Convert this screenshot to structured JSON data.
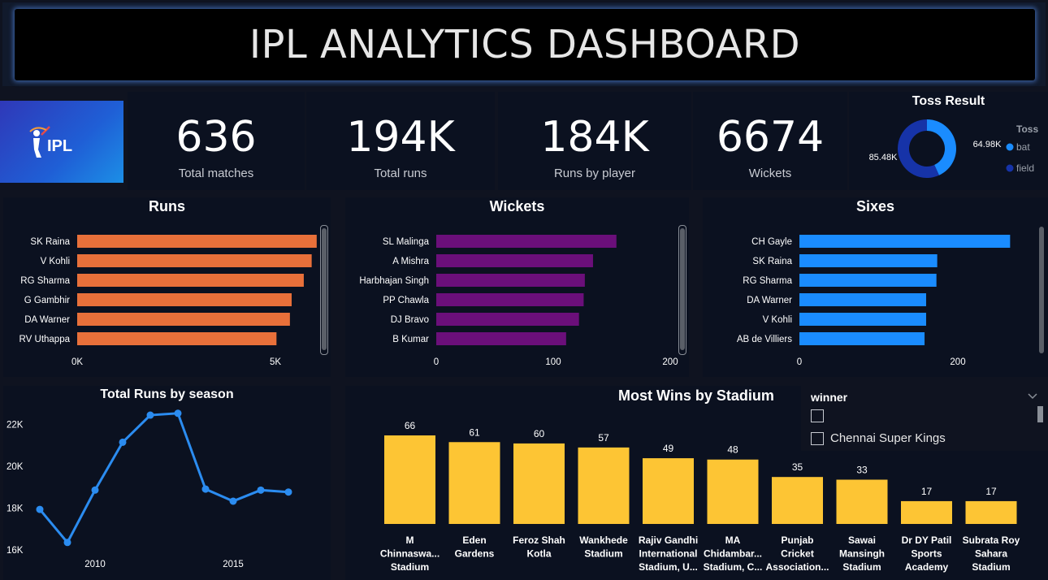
{
  "header": {
    "title": "IPL ANALYTICS DASHBOARD"
  },
  "logo": {
    "text": "IPL"
  },
  "kpis": [
    {
      "value": "636",
      "label": "Total matches"
    },
    {
      "value": "194K",
      "label": "Total runs"
    },
    {
      "value": "184K",
      "label": "Runs by player"
    },
    {
      "value": "6674",
      "label": "Wickets"
    }
  ],
  "toss": {
    "title": "Toss Result",
    "legend_title": "Toss",
    "slices": [
      {
        "name": "bat",
        "label": "64.98K",
        "value": 64.98,
        "color": "#1a8cff"
      },
      {
        "name": "field",
        "label": "85.48K",
        "value": 85.48,
        "color": "#1633a8"
      }
    ]
  },
  "filter": {
    "title": "winner",
    "options": [
      "",
      "Chennai Super Kings"
    ]
  },
  "colors": {
    "runs": "#e8703a",
    "wickets": "#6b0f7a",
    "sixes": "#1a8cff",
    "line": "#2b8cf0",
    "stadium": "#fdc534"
  },
  "chart_data": [
    {
      "type": "bar",
      "title": "Runs",
      "orientation": "horizontal",
      "categories": [
        "SK Raina",
        "V Kohli",
        "RG Sharma",
        "G Gambhir",
        "DA Warner",
        "RV Uthappa"
      ],
      "values": [
        5528,
        5412,
        5230,
        4950,
        4910,
        4600
      ],
      "xticks": [
        "0K",
        "5K"
      ],
      "xlim": [
        0,
        6000
      ]
    },
    {
      "type": "bar",
      "title": "Wickets",
      "orientation": "horizontal",
      "categories": [
        "SL Malinga",
        "A Mishra",
        "Harbhajan Singh",
        "PP Chawla",
        "DJ Bravo",
        "B Kumar"
      ],
      "values": [
        154,
        134,
        127,
        126,
        122,
        111
      ],
      "xticks": [
        "0",
        "100",
        "200"
      ],
      "xlim": [
        0,
        200
      ]
    },
    {
      "type": "bar",
      "title": "Sixes",
      "orientation": "horizontal",
      "categories": [
        "CH Gayle",
        "SK Raina",
        "RG Sharma",
        "DA Warner",
        "V Kohli",
        "AB de Villiers"
      ],
      "values": [
        266,
        174,
        173,
        160,
        160,
        158
      ],
      "xticks": [
        "0",
        "200"
      ],
      "xlim": [
        0,
        320
      ]
    },
    {
      "type": "line",
      "title": "Total Runs by season",
      "x": [
        2008,
        2009,
        2010,
        2011,
        2012,
        2013,
        2014,
        2015,
        2016,
        2017
      ],
      "y": [
        17937,
        16353,
        18864,
        21154,
        22453,
        22541,
        18909,
        18332,
        18862,
        18769
      ],
      "xticks": [
        "2010",
        "2015"
      ],
      "yticks": [
        "16K",
        "18K",
        "20K",
        "22K"
      ],
      "ylim": [
        15800,
        23000
      ]
    },
    {
      "type": "bar",
      "title": "Most Wins by Stadium",
      "categories": [
        "M Chinnaswa... Stadium",
        "Eden Gardens",
        "Feroz Shah Kotla",
        "Wankhede Stadium",
        "Rajiv Gandhi International Stadium, U...",
        "MA Chidambar... Stadium, C...",
        "Punjab Cricket Association...",
        "Sawai Mansingh Stadium",
        "Dr DY Patil Sports Academy",
        "Subrata Roy Sahara Stadium"
      ],
      "category_lines": [
        [
          "M",
          "Chinnaswa...",
          "Stadium"
        ],
        [
          "Eden",
          "Gardens"
        ],
        [
          "Feroz Shah",
          "Kotla"
        ],
        [
          "Wankhede",
          "Stadium"
        ],
        [
          "Rajiv Gandhi",
          "International",
          "Stadium, U..."
        ],
        [
          "MA",
          "Chidambar...",
          "Stadium, C..."
        ],
        [
          "Punjab",
          "Cricket",
          "Association..."
        ],
        [
          "Sawai",
          "Mansingh",
          "Stadium"
        ],
        [
          "Dr DY Patil",
          "Sports",
          "Academy"
        ],
        [
          "Subrata Roy",
          "Sahara",
          "Stadium"
        ]
      ],
      "values": [
        66,
        61,
        60,
        57,
        49,
        48,
        35,
        33,
        17,
        17
      ],
      "data_labels": [
        "66",
        "61",
        "60",
        "57",
        "49",
        "48",
        "35",
        "33",
        "17",
        "17"
      ],
      "ylim": [
        0,
        70
      ]
    }
  ]
}
